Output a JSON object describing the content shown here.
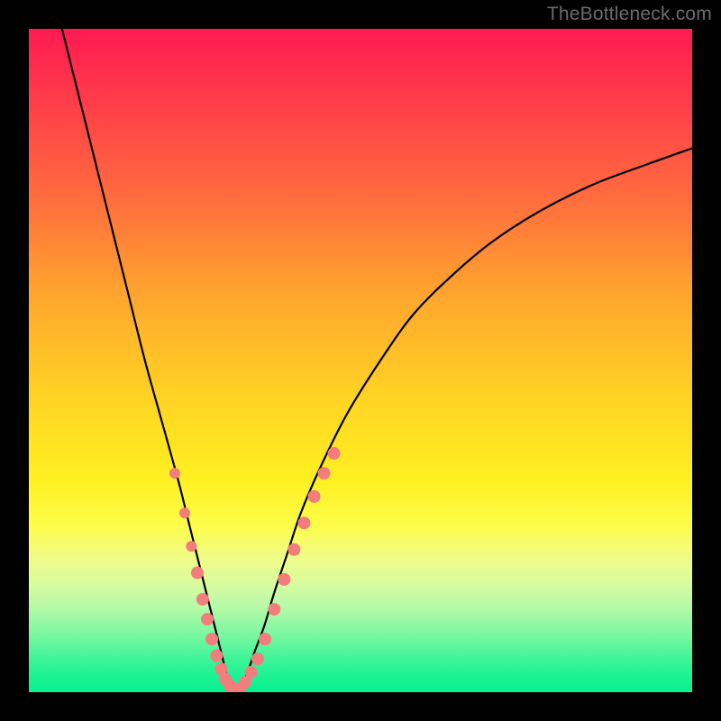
{
  "watermark": "TheBottleneck.com",
  "colors": {
    "background": "#000000",
    "curve": "#000000",
    "marker": "#f37d7d",
    "gradient_top": "#ff1a52",
    "gradient_bottom": "#07f190"
  },
  "chart_data": {
    "type": "line",
    "title": "",
    "xlabel": "",
    "ylabel": "",
    "xlim": [
      0,
      100
    ],
    "ylim": [
      0,
      100
    ],
    "grid": false,
    "legend": false,
    "description": "V-shaped bottleneck curve over red-to-green gradient; minimum near x≈30 at y≈0. Pink markers cluster around the minimum on both branches.",
    "series": [
      {
        "name": "curve",
        "color": "#000000",
        "x": [
          5,
          7.5,
          10,
          12.5,
          15,
          17.5,
          20,
          22.5,
          24,
          25.5,
          27,
          28,
          29,
          30,
          31,
          32,
          33,
          34,
          35.5,
          37,
          39,
          41,
          44,
          48,
          53,
          58,
          64,
          70,
          77,
          85,
          93,
          100
        ],
        "y": [
          100,
          90,
          80,
          70,
          60,
          50,
          41,
          32,
          26,
          20,
          14,
          10,
          6,
          2,
          0,
          1,
          3,
          6,
          10,
          15,
          21,
          27,
          34,
          42,
          50,
          57,
          63,
          68,
          72.5,
          76.5,
          79.5,
          82
        ]
      }
    ],
    "markers": [
      {
        "x": 22.0,
        "y": 33.0,
        "r": 6
      },
      {
        "x": 23.5,
        "y": 27.0,
        "r": 6
      },
      {
        "x": 24.5,
        "y": 22.0,
        "r": 6
      },
      {
        "x": 25.4,
        "y": 18.0,
        "r": 7
      },
      {
        "x": 26.2,
        "y": 14.0,
        "r": 7
      },
      {
        "x": 26.9,
        "y": 11.0,
        "r": 7
      },
      {
        "x": 27.6,
        "y": 8.0,
        "r": 7
      },
      {
        "x": 28.3,
        "y": 5.5,
        "r": 7
      },
      {
        "x": 29.0,
        "y": 3.5,
        "r": 7
      },
      {
        "x": 29.6,
        "y": 2.0,
        "r": 7
      },
      {
        "x": 30.3,
        "y": 1.0,
        "r": 7
      },
      {
        "x": 31.0,
        "y": 0.5,
        "r": 7
      },
      {
        "x": 31.8,
        "y": 0.5,
        "r": 7
      },
      {
        "x": 32.6,
        "y": 1.5,
        "r": 7
      },
      {
        "x": 33.5,
        "y": 3.0,
        "r": 7
      },
      {
        "x": 34.5,
        "y": 5.0,
        "r": 7
      },
      {
        "x": 35.6,
        "y": 8.0,
        "r": 7
      },
      {
        "x": 37.0,
        "y": 12.5,
        "r": 7
      },
      {
        "x": 38.5,
        "y": 17.0,
        "r": 7
      },
      {
        "x": 40.0,
        "y": 21.5,
        "r": 7
      },
      {
        "x": 41.5,
        "y": 25.5,
        "r": 7
      },
      {
        "x": 43.0,
        "y": 29.5,
        "r": 7
      },
      {
        "x": 44.5,
        "y": 33.0,
        "r": 7
      },
      {
        "x": 46.0,
        "y": 36.0,
        "r": 7
      }
    ]
  }
}
